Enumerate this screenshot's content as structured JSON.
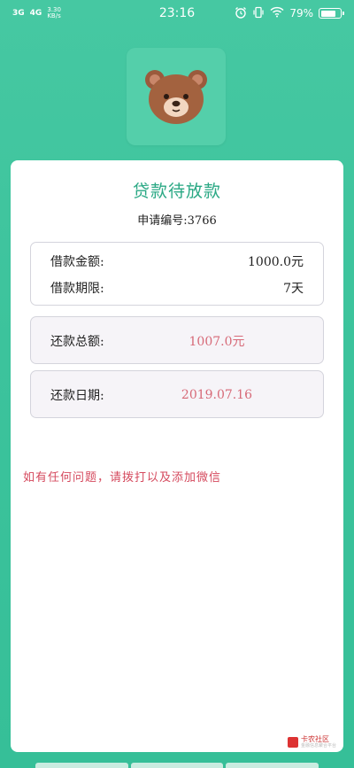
{
  "status_bar": {
    "signal_1": "3G",
    "signal_2": "4G",
    "net_speed": "3.30",
    "net_speed_unit": "KB/s",
    "time": "23:16",
    "battery_percent": "79%",
    "battery_level": 0.79
  },
  "colors": {
    "background": "#3fc59e",
    "title": "#2aa884",
    "amount_red": "#d76a78",
    "notice_red": "#d54a5e"
  },
  "page": {
    "title": "贷款待放款",
    "application_number": "申请编号:3766"
  },
  "loan": {
    "amount_label": "借款金额:",
    "amount_value": "1000.0元",
    "term_label": "借款期限:",
    "term_value": "7天"
  },
  "repayment": {
    "total_label": "还款总额:",
    "total_value": "1007.0元",
    "date_label": "还款日期:",
    "date_value": "2019.07.16"
  },
  "notice": "如有任何问题，请拨打以及添加微信",
  "watermark": {
    "text": "卡农社区",
    "subtext": "金融信息聚合平台"
  }
}
